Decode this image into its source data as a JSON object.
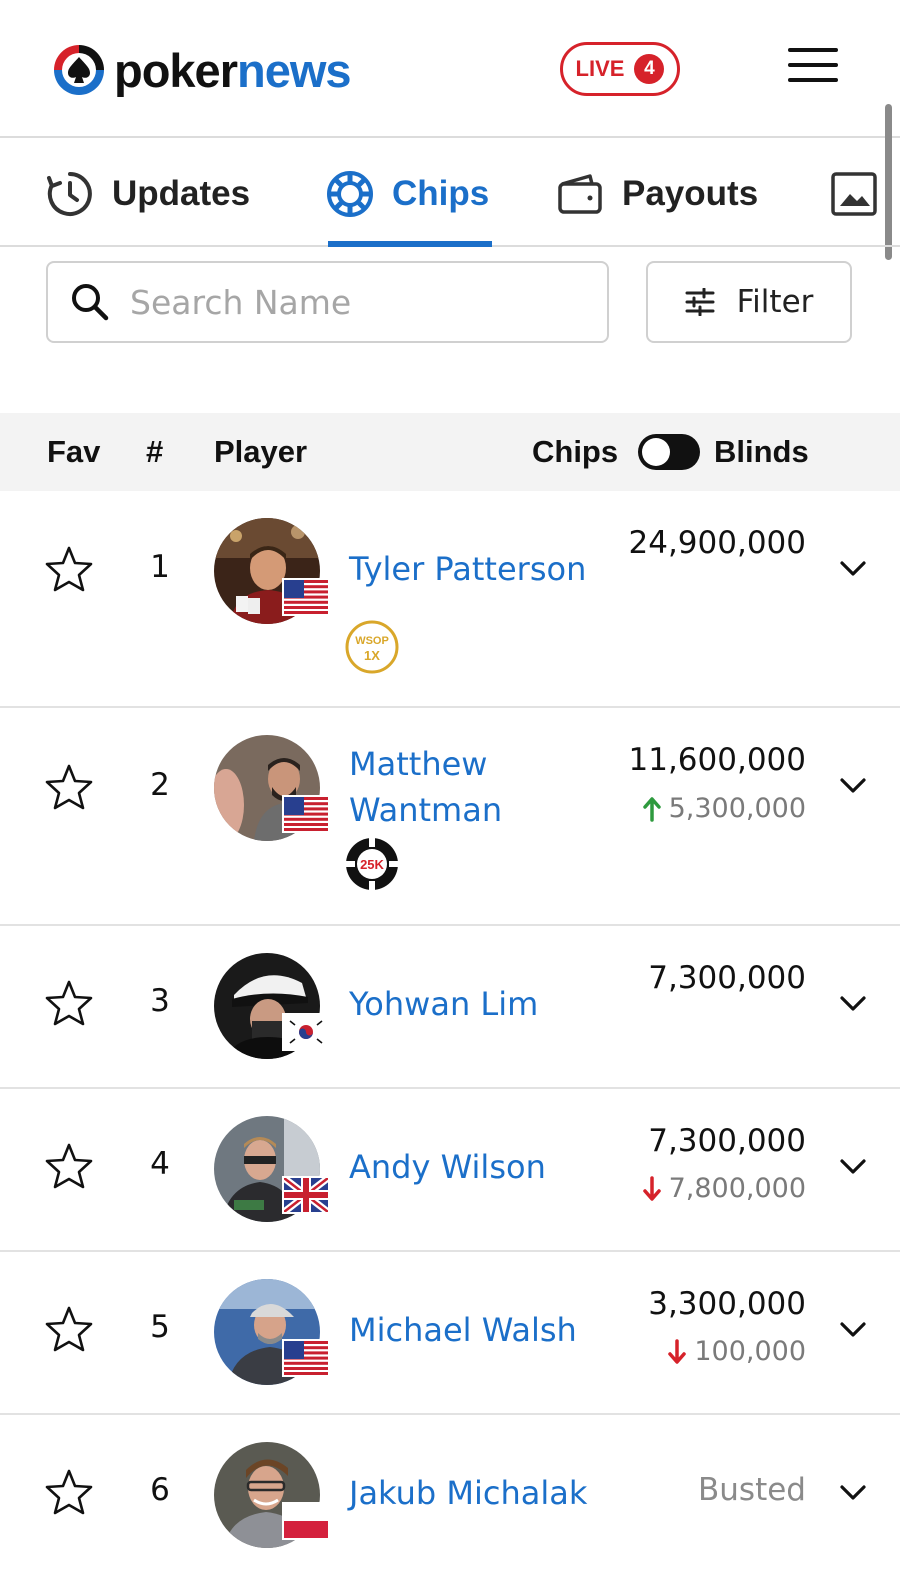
{
  "header": {
    "logo_part1": "poker",
    "logo_part2": "news",
    "live_label": "LIVE",
    "live_count": "4"
  },
  "tabs": [
    {
      "label": "Updates",
      "icon": "history-icon",
      "active": false
    },
    {
      "label": "Chips",
      "icon": "chip-icon",
      "active": true
    },
    {
      "label": "Payouts",
      "icon": "wallet-icon",
      "active": false
    },
    {
      "label": "",
      "icon": "gallery-icon",
      "active": false
    }
  ],
  "search": {
    "placeholder": "Search Name",
    "value": ""
  },
  "filter": {
    "label": "Filter"
  },
  "table": {
    "col_fav": "Fav",
    "col_rank": "#",
    "col_player": "Player",
    "toggle_left": "Chips",
    "toggle_right": "Blinds"
  },
  "rows": [
    {
      "rank": "1",
      "name_lines": [
        "Tyler Patterson"
      ],
      "chips": "24,900,000",
      "change": "",
      "change_dir": "",
      "flag": "us",
      "badge": "wsop-1x",
      "badge_text": "WSOP 1X"
    },
    {
      "rank": "2",
      "name_lines": [
        "Matthew",
        "Wantman"
      ],
      "chips": "11,600,000",
      "change": "5,300,000",
      "change_dir": "up",
      "flag": "us",
      "badge": "25k-chip",
      "badge_text": "25K"
    },
    {
      "rank": "3",
      "name_lines": [
        "Yohwan Lim"
      ],
      "chips": "7,300,000",
      "change": "",
      "change_dir": "",
      "flag": "kr",
      "badge": "",
      "badge_text": ""
    },
    {
      "rank": "4",
      "name_lines": [
        "Andy Wilson"
      ],
      "chips": "7,300,000",
      "change": "7,800,000",
      "change_dir": "down",
      "flag": "uk",
      "badge": "",
      "badge_text": ""
    },
    {
      "rank": "5",
      "name_lines": [
        "Michael Walsh"
      ],
      "chips": "3,300,000",
      "change": "100,000",
      "change_dir": "down",
      "flag": "us",
      "badge": "",
      "badge_text": ""
    },
    {
      "rank": "6",
      "name_lines": [
        "Jakub Michalak"
      ],
      "chips": "",
      "status": "Busted",
      "change": "",
      "change_dir": "",
      "flag": "pl",
      "badge": "",
      "badge_text": ""
    }
  ],
  "colors": {
    "brand_blue": "#1b6fc9",
    "live_red": "#d6222a",
    "up_green": "#2e9a3e",
    "down_red": "#d6222a"
  }
}
